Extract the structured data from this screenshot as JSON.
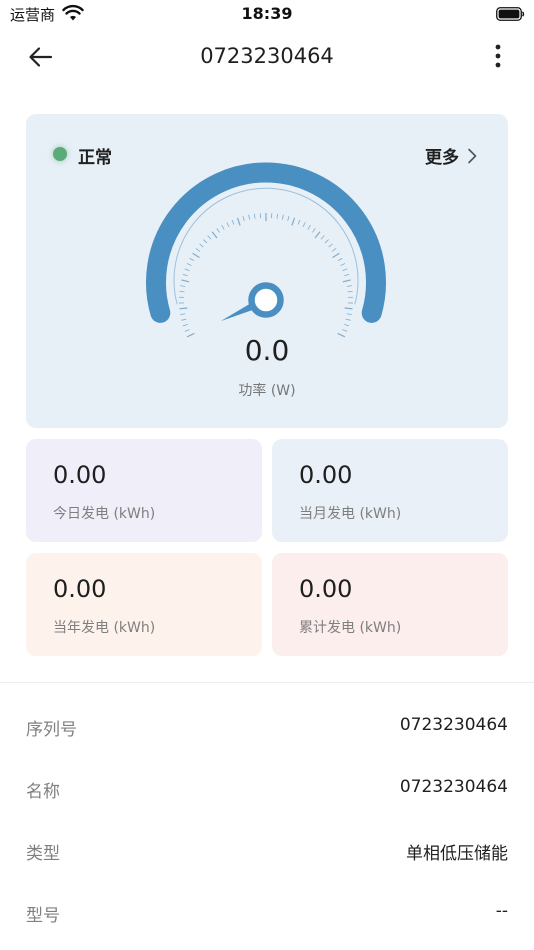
{
  "status_bar": {
    "carrier": "运营商",
    "time": "18:39"
  },
  "nav": {
    "title": "0723230464"
  },
  "gauge": {
    "status": "正常",
    "more_label": "更多",
    "value": "0.0",
    "unit_label": "功率 (W)",
    "level": 0,
    "colors": {
      "arc": "#4a8fc2",
      "status_dot": "#5bab7a"
    }
  },
  "stats": [
    {
      "value": "0.00",
      "label": "今日发电 (kWh)",
      "bg": "#efeef9"
    },
    {
      "value": "0.00",
      "label": "当月发电 (kWh)",
      "bg": "#e9f0f7"
    },
    {
      "value": "0.00",
      "label": "当年发电 (kWh)",
      "bg": "#fdf3ec"
    },
    {
      "value": "0.00",
      "label": "累计发电 (kWh)",
      "bg": "#fbeeec"
    }
  ],
  "info": [
    {
      "label": "序列号",
      "value": "0723230464"
    },
    {
      "label": "名称",
      "value": "0723230464"
    },
    {
      "label": "类型",
      "value": "单相低压储能"
    },
    {
      "label": "型号",
      "value": "--"
    }
  ]
}
